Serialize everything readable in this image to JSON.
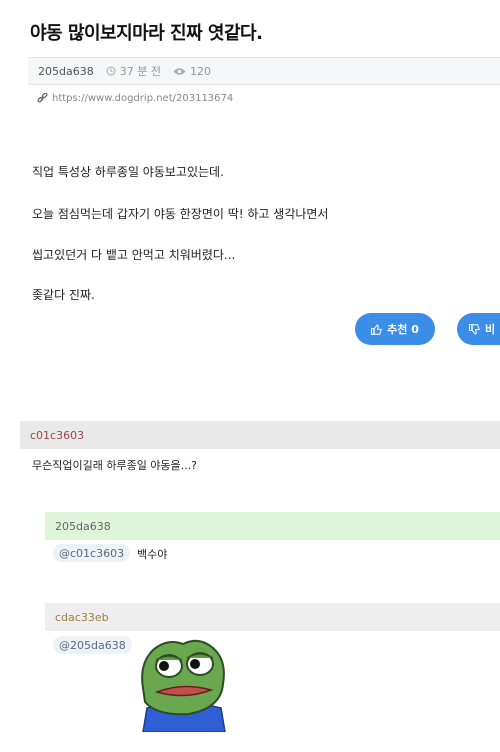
{
  "post": {
    "title": "야동 많이보지마라 진짜 엿같다.",
    "author": "205da638",
    "time": "37 분 전",
    "views": "120",
    "url": "https://www.dogdrip.net/203113674"
  },
  "content": {
    "lines": [
      "직업 특성상 하루종일 야동보고있는데.",
      "오늘 점심먹는데 갑자기 야동 한장면이 딱! 하고 생각나면서",
      "씹고있던거 다 뱉고 안먹고 치워버렸다...",
      "좆같다 진짜."
    ]
  },
  "votes": {
    "up_label": "추천 0",
    "down_label": "비"
  },
  "comments": [
    {
      "author": "c01c3603",
      "text": "무슨직업이길래 하루종일 야동을...?"
    },
    {
      "author": "205da638",
      "mention": "@c01c3603",
      "text": "백수야"
    },
    {
      "author": "cdac33eb",
      "mention": "@205da638"
    }
  ],
  "colors": {
    "accent": "#3a8ee8",
    "reply_author_bg": "#dff5da",
    "comment_header_bg": "#e9e9e9"
  },
  "icons": [
    "clock-icon",
    "eye-icon",
    "link-icon",
    "thumbs-up-icon",
    "thumbs-down-icon"
  ]
}
